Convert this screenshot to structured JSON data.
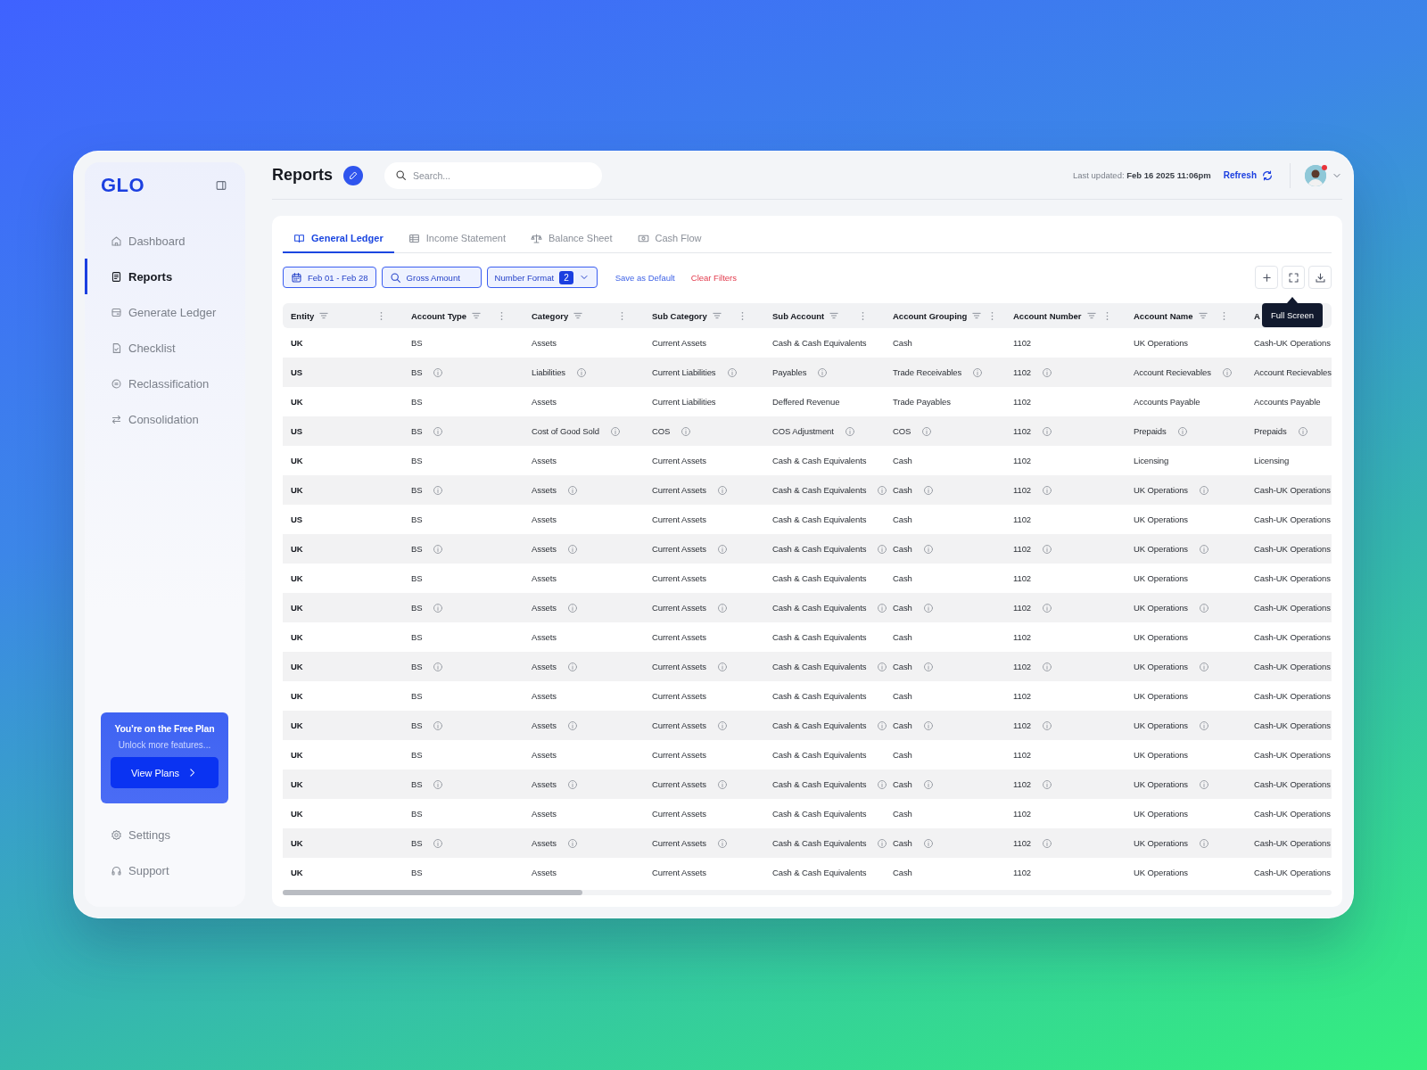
{
  "sidebar": {
    "logo": "GLO",
    "nav": [
      {
        "label": "Dashboard",
        "selected": false
      },
      {
        "label": "Reports",
        "selected": true
      },
      {
        "label": "Generate Ledger",
        "selected": false
      },
      {
        "label": "Checklist",
        "selected": false
      },
      {
        "label": "Reclassification",
        "selected": false
      },
      {
        "label": "Consolidation",
        "selected": false
      }
    ],
    "plan": {
      "title": "You’re on the Free Plan",
      "subtitle": "Unlock more features...",
      "button": "View Plans"
    },
    "footer": [
      {
        "label": "Settings"
      },
      {
        "label": "Support"
      }
    ]
  },
  "header": {
    "title": "Reports",
    "search": {
      "placeholder": "Search..."
    },
    "last_updated": "Last updated: **Feb 16 2025 11:06pm**",
    "refresh": "Refresh",
    "notification": true
  },
  "tabs": [
    {
      "label": "General Ledger",
      "selected": true
    },
    {
      "label": "Income Statement",
      "selected": false
    },
    {
      "label": "Balance Sheet",
      "selected": false
    },
    {
      "label": "Cash Flow",
      "selected": false
    }
  ],
  "filters": {
    "date": "Feb 01 - Feb 28",
    "amount": "Gross Amount",
    "format": {
      "label": "Number Format",
      "count": "2"
    },
    "save": "Save as Default",
    "clear": "Clear Filters"
  },
  "tooltip": "Full Screen",
  "table": {
    "columns": [
      {
        "label": "Entity",
        "filter": true
      },
      {
        "label": "Account Type",
        "filter": true
      },
      {
        "label": "Category",
        "filter": true
      },
      {
        "label": "Sub Category",
        "filter": true
      },
      {
        "label": "Sub Account",
        "filter": true
      },
      {
        "label": "Account Grouping",
        "filter": true
      },
      {
        "label": "Account Number",
        "filter": true
      },
      {
        "label": "Account Name",
        "filter": true
      },
      {
        "label": "A",
        "filter": false
      }
    ],
    "rows": [
      {
        "cells": [
          {
            "text": "UK",
            "info": false
          },
          {
            "text": "BS",
            "info": false
          },
          {
            "text": "Assets",
            "info": false
          },
          {
            "text": "Current Assets",
            "info": false
          },
          {
            "text": "Cash & Cash Equivalents",
            "info": false
          },
          {
            "text": "Cash",
            "info": false
          },
          {
            "text": "1102",
            "info": false
          },
          {
            "text": "UK Operations",
            "info": false
          },
          {
            "text": "Cash-UK Operations",
            "info": false
          }
        ]
      },
      {
        "cells": [
          {
            "text": "US",
            "info": false
          },
          {
            "text": "BS",
            "info": true
          },
          {
            "text": "Liabilities",
            "info": true
          },
          {
            "text": "Current Liabilities",
            "info": true
          },
          {
            "text": "Payables",
            "info": true
          },
          {
            "text": "Trade Receivables",
            "info": true
          },
          {
            "text": "1102",
            "info": true
          },
          {
            "text": "Account Recievables",
            "info": true
          },
          {
            "text": "Account Recievables",
            "info": false
          }
        ]
      },
      {
        "cells": [
          {
            "text": "UK",
            "info": false
          },
          {
            "text": "BS",
            "info": false
          },
          {
            "text": "Assets",
            "info": false
          },
          {
            "text": "Current Liabilities",
            "info": false
          },
          {
            "text": "Deffered Revenue",
            "info": false
          },
          {
            "text": "Trade Payables",
            "info": false
          },
          {
            "text": "1102",
            "info": false
          },
          {
            "text": "Accounts Payable",
            "info": false
          },
          {
            "text": "Accounts Payable",
            "info": false
          }
        ]
      },
      {
        "cells": [
          {
            "text": "US",
            "info": false
          },
          {
            "text": "BS",
            "info": true
          },
          {
            "text": "Cost of Good Sold",
            "info": true
          },
          {
            "text": "COS",
            "info": true
          },
          {
            "text": "COS Adjustment",
            "info": true
          },
          {
            "text": "COS",
            "info": true
          },
          {
            "text": "1102",
            "info": true
          },
          {
            "text": "Prepaids",
            "info": true
          },
          {
            "text": "Prepaids",
            "info": true
          }
        ]
      },
      {
        "cells": [
          {
            "text": "UK",
            "info": false
          },
          {
            "text": "BS",
            "info": false
          },
          {
            "text": "Assets",
            "info": false
          },
          {
            "text": "Current Assets",
            "info": false
          },
          {
            "text": "Cash & Cash Equivalents",
            "info": false
          },
          {
            "text": "Cash",
            "info": false
          },
          {
            "text": "1102",
            "info": false
          },
          {
            "text": "Licensing",
            "info": false
          },
          {
            "text": "Licensing",
            "info": false
          }
        ]
      },
      {
        "cells": [
          {
            "text": "UK",
            "info": false
          },
          {
            "text": "BS",
            "info": true
          },
          {
            "text": "Assets",
            "info": true
          },
          {
            "text": "Current Assets",
            "info": true
          },
          {
            "text": "Cash & Cash Equivalents",
            "info": true
          },
          {
            "text": "Cash",
            "info": true
          },
          {
            "text": "1102",
            "info": true
          },
          {
            "text": "UK Operations",
            "info": true
          },
          {
            "text": "Cash-UK Operations",
            "info": false
          }
        ]
      },
      {
        "cells": [
          {
            "text": "US",
            "info": false
          },
          {
            "text": "BS",
            "info": false
          },
          {
            "text": "Assets",
            "info": false
          },
          {
            "text": "Current Assets",
            "info": false
          },
          {
            "text": "Cash & Cash Equivalents",
            "info": false
          },
          {
            "text": "Cash",
            "info": false
          },
          {
            "text": "1102",
            "info": false
          },
          {
            "text": "UK Operations",
            "info": false
          },
          {
            "text": "Cash-UK Operations",
            "info": false
          }
        ]
      },
      {
        "cells": [
          {
            "text": "UK",
            "info": false
          },
          {
            "text": "BS",
            "info": true
          },
          {
            "text": "Assets",
            "info": true
          },
          {
            "text": "Current Assets",
            "info": true
          },
          {
            "text": "Cash & Cash Equivalents",
            "info": true
          },
          {
            "text": "Cash",
            "info": true
          },
          {
            "text": "1102",
            "info": true
          },
          {
            "text": "UK Operations",
            "info": true
          },
          {
            "text": "Cash-UK Operations",
            "info": false
          }
        ]
      },
      {
        "cells": [
          {
            "text": "UK",
            "info": false
          },
          {
            "text": "BS",
            "info": false
          },
          {
            "text": "Assets",
            "info": false
          },
          {
            "text": "Current Assets",
            "info": false
          },
          {
            "text": "Cash & Cash Equivalents",
            "info": false
          },
          {
            "text": "Cash",
            "info": false
          },
          {
            "text": "1102",
            "info": false
          },
          {
            "text": "UK Operations",
            "info": false
          },
          {
            "text": "Cash-UK Operations",
            "info": false
          }
        ]
      },
      {
        "cells": [
          {
            "text": "UK",
            "info": false
          },
          {
            "text": "BS",
            "info": true
          },
          {
            "text": "Assets",
            "info": true
          },
          {
            "text": "Current Assets",
            "info": true
          },
          {
            "text": "Cash & Cash Equivalents",
            "info": true
          },
          {
            "text": "Cash",
            "info": true
          },
          {
            "text": "1102",
            "info": true
          },
          {
            "text": "UK Operations",
            "info": true
          },
          {
            "text": "Cash-UK Operations",
            "info": false
          }
        ]
      },
      {
        "cells": [
          {
            "text": "UK",
            "info": false
          },
          {
            "text": "BS",
            "info": false
          },
          {
            "text": "Assets",
            "info": false
          },
          {
            "text": "Current Assets",
            "info": false
          },
          {
            "text": "Cash & Cash Equivalents",
            "info": false
          },
          {
            "text": "Cash",
            "info": false
          },
          {
            "text": "1102",
            "info": false
          },
          {
            "text": "UK Operations",
            "info": false
          },
          {
            "text": "Cash-UK Operations",
            "info": false
          }
        ]
      },
      {
        "cells": [
          {
            "text": "UK",
            "info": false
          },
          {
            "text": "BS",
            "info": true
          },
          {
            "text": "Assets",
            "info": true
          },
          {
            "text": "Current Assets",
            "info": true
          },
          {
            "text": "Cash & Cash Equivalents",
            "info": true
          },
          {
            "text": "Cash",
            "info": true
          },
          {
            "text": "1102",
            "info": true
          },
          {
            "text": "UK Operations",
            "info": true
          },
          {
            "text": "Cash-UK Operations",
            "info": false
          }
        ]
      },
      {
        "cells": [
          {
            "text": "UK",
            "info": false
          },
          {
            "text": "BS",
            "info": false
          },
          {
            "text": "Assets",
            "info": false
          },
          {
            "text": "Current Assets",
            "info": false
          },
          {
            "text": "Cash & Cash Equivalents",
            "info": false
          },
          {
            "text": "Cash",
            "info": false
          },
          {
            "text": "1102",
            "info": false
          },
          {
            "text": "UK Operations",
            "info": false
          },
          {
            "text": "Cash-UK Operations",
            "info": false
          }
        ]
      },
      {
        "cells": [
          {
            "text": "UK",
            "info": false
          },
          {
            "text": "BS",
            "info": true
          },
          {
            "text": "Assets",
            "info": true
          },
          {
            "text": "Current Assets",
            "info": true
          },
          {
            "text": "Cash & Cash Equivalents",
            "info": true
          },
          {
            "text": "Cash",
            "info": true
          },
          {
            "text": "1102",
            "info": true
          },
          {
            "text": "UK Operations",
            "info": true
          },
          {
            "text": "Cash-UK Operations",
            "info": false
          }
        ]
      },
      {
        "cells": [
          {
            "text": "UK",
            "info": false
          },
          {
            "text": "BS",
            "info": false
          },
          {
            "text": "Assets",
            "info": false
          },
          {
            "text": "Current Assets",
            "info": false
          },
          {
            "text": "Cash & Cash Equivalents",
            "info": false
          },
          {
            "text": "Cash",
            "info": false
          },
          {
            "text": "1102",
            "info": false
          },
          {
            "text": "UK Operations",
            "info": false
          },
          {
            "text": "Cash-UK Operations",
            "info": false
          }
        ]
      },
      {
        "cells": [
          {
            "text": "UK",
            "info": false
          },
          {
            "text": "BS",
            "info": true
          },
          {
            "text": "Assets",
            "info": true
          },
          {
            "text": "Current Assets",
            "info": true
          },
          {
            "text": "Cash & Cash Equivalents",
            "info": true
          },
          {
            "text": "Cash",
            "info": true
          },
          {
            "text": "1102",
            "info": true
          },
          {
            "text": "UK Operations",
            "info": true
          },
          {
            "text": "Cash-UK Operations",
            "info": false
          }
        ]
      },
      {
        "cells": [
          {
            "text": "UK",
            "info": false
          },
          {
            "text": "BS",
            "info": false
          },
          {
            "text": "Assets",
            "info": false
          },
          {
            "text": "Current Assets",
            "info": false
          },
          {
            "text": "Cash & Cash Equivalents",
            "info": false
          },
          {
            "text": "Cash",
            "info": false
          },
          {
            "text": "1102",
            "info": false
          },
          {
            "text": "UK Operations",
            "info": false
          },
          {
            "text": "Cash-UK Operations",
            "info": false
          }
        ]
      },
      {
        "cells": [
          {
            "text": "UK",
            "info": false
          },
          {
            "text": "BS",
            "info": true
          },
          {
            "text": "Assets",
            "info": true
          },
          {
            "text": "Current Assets",
            "info": true
          },
          {
            "text": "Cash & Cash Equivalents",
            "info": true
          },
          {
            "text": "Cash",
            "info": true
          },
          {
            "text": "1102",
            "info": true
          },
          {
            "text": "UK Operations",
            "info": true
          },
          {
            "text": "Cash-UK Operations",
            "info": false
          }
        ]
      },
      {
        "cells": [
          {
            "text": "UK",
            "info": false
          },
          {
            "text": "BS",
            "info": false
          },
          {
            "text": "Assets",
            "info": false
          },
          {
            "text": "Current Assets",
            "info": false
          },
          {
            "text": "Cash & Cash Equivalents",
            "info": false
          },
          {
            "text": "Cash",
            "info": false
          },
          {
            "text": "1102",
            "info": false
          },
          {
            "text": "UK Operations",
            "info": false
          },
          {
            "text": "Cash-UK Operations",
            "info": false
          }
        ]
      }
    ]
  }
}
